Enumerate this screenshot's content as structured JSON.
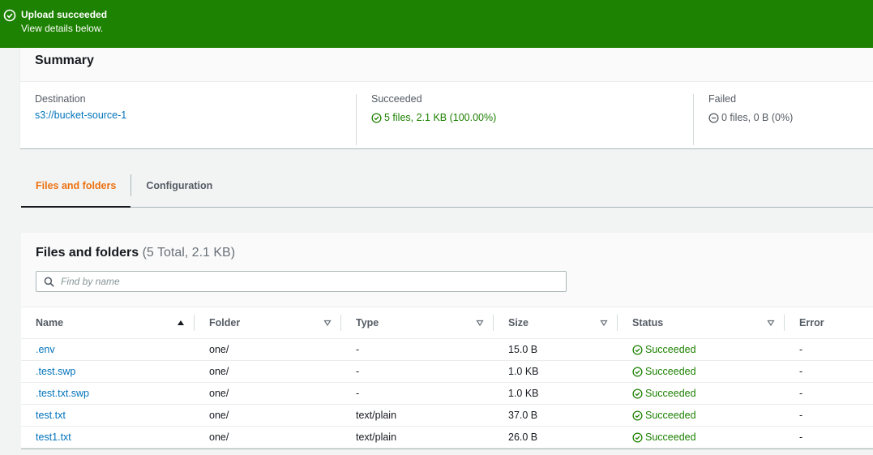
{
  "flash": {
    "title": "Upload succeeded",
    "message": "View details below."
  },
  "summary": {
    "title": "Summary",
    "destination_label": "Destination",
    "destination_value": "s3://bucket-source-1",
    "succeeded_label": "Succeeded",
    "succeeded_value": "5 files, 2.1 KB (100.00%)",
    "failed_label": "Failed",
    "failed_value": "0 files, 0 B (0%)"
  },
  "tabs": [
    {
      "label": "Files and folders",
      "active": true
    },
    {
      "label": "Configuration",
      "active": false
    }
  ],
  "files": {
    "title": "Files and folders",
    "count": "(5 Total, 2.1 KB)",
    "search_placeholder": "Find by name",
    "columns": [
      "Name",
      "Folder",
      "Type",
      "Size",
      "Status",
      "Error"
    ],
    "rows": [
      {
        "name": ".env",
        "folder": "one/",
        "type": "-",
        "size": "15.0 B",
        "status": "Succeeded",
        "error": "-"
      },
      {
        "name": ".test.swp",
        "folder": "one/",
        "type": "-",
        "size": "1.0 KB",
        "status": "Succeeded",
        "error": "-"
      },
      {
        "name": ".test.txt.swp",
        "folder": "one/",
        "type": "-",
        "size": "1.0 KB",
        "status": "Succeeded",
        "error": "-"
      },
      {
        "name": "test.txt",
        "folder": "one/",
        "type": "text/plain",
        "size": "37.0 B",
        "status": "Succeeded",
        "error": "-"
      },
      {
        "name": "test1.txt",
        "folder": "one/",
        "type": "text/plain",
        "size": "26.0 B",
        "status": "Succeeded",
        "error": "-"
      }
    ]
  },
  "colors": {
    "success": "#1d8102",
    "link": "#0073bb",
    "tab_active": "#ec7211"
  }
}
